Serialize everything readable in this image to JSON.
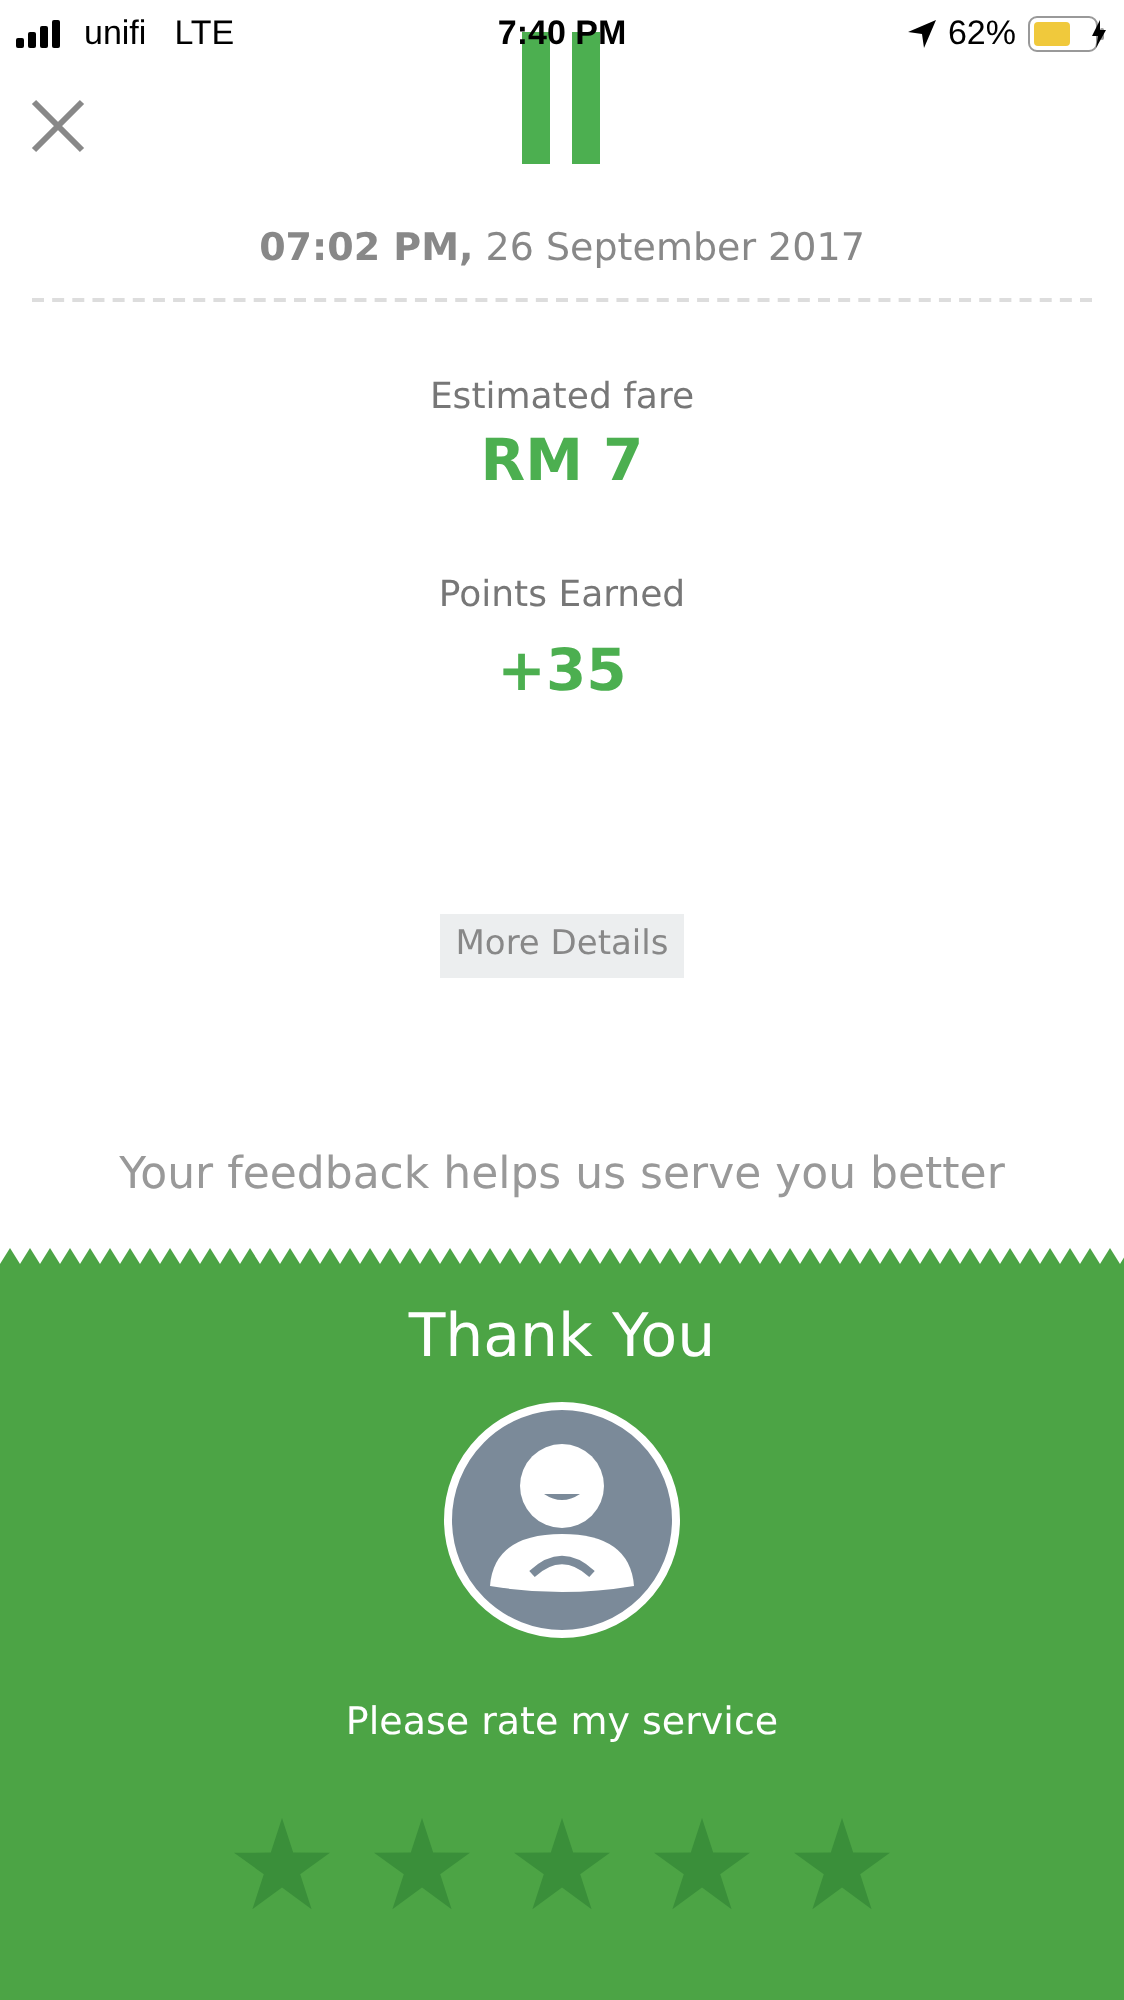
{
  "status_bar": {
    "carrier": "unifi",
    "network": "LTE",
    "time": "7:40 PM",
    "battery": "62%"
  },
  "trip": {
    "datetime": "**07:02 PM,** 26 September 2017",
    "fare_label": "Estimated fare",
    "fare": "RM 7",
    "points_label": "Points Earned",
    "points": "+35",
    "details_button": "More Details",
    "feedback": "Your feedback helps us serve you better"
  },
  "rating": {
    "title": "Thank You",
    "prompt": "Please rate my service"
  }
}
